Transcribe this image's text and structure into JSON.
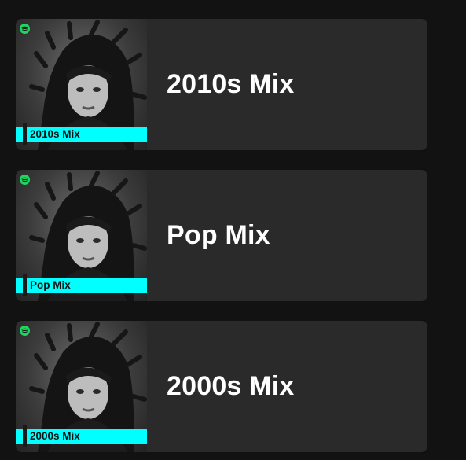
{
  "colors": {
    "background": "#121212",
    "card": "#2a2a2a",
    "label_accent": "#00ffff",
    "brand_green": "#1ed760",
    "title_text": "#ffffff"
  },
  "mixes": [
    {
      "title": "2010s Mix",
      "cover_label": "2010s Mix",
      "icon": "spotify-logo-icon"
    },
    {
      "title": "Pop Mix",
      "cover_label": "Pop Mix",
      "icon": "spotify-logo-icon"
    },
    {
      "title": "2000s Mix",
      "cover_label": "2000s Mix",
      "icon": "spotify-logo-icon"
    }
  ]
}
